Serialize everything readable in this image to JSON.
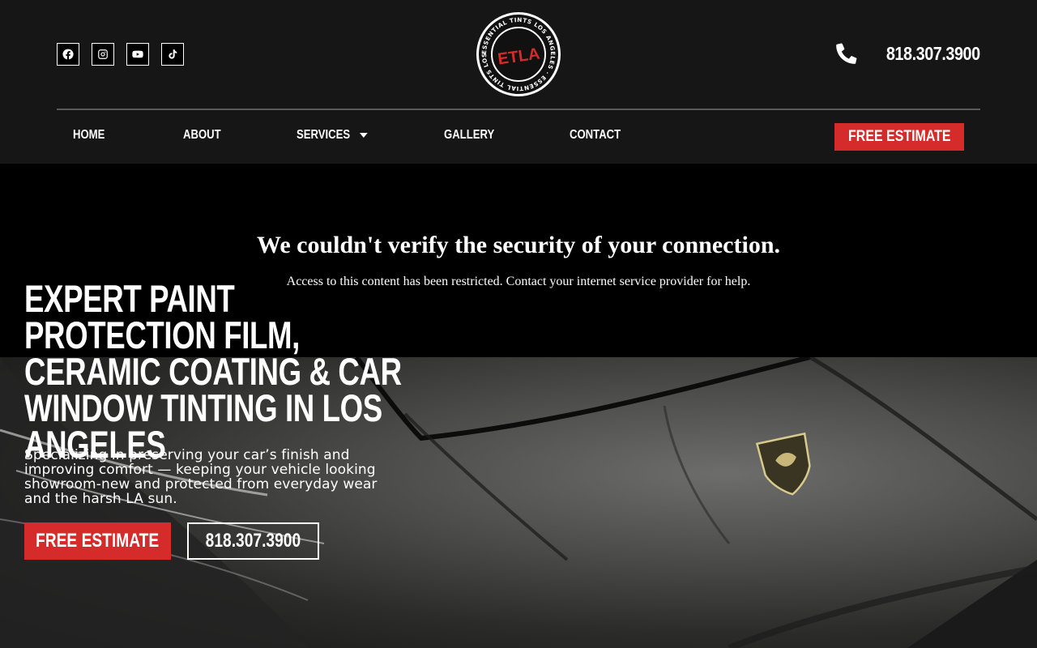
{
  "header": {
    "socials": [
      {
        "icon": "facebook-icon"
      },
      {
        "icon": "instagram-icon"
      },
      {
        "icon": "youtube-icon"
      },
      {
        "icon": "tiktok-icon"
      }
    ],
    "logo": {
      "ring_text": "ESSENTIAL TINTS LOS ANGELES · ESSENTIAL TINTS LOS ANGELES ·",
      "monogram": "ETLA"
    },
    "phone": "818.307.3900"
  },
  "nav": {
    "items": [
      "HOME",
      "ABOUT",
      "SERVICES",
      "GALLERY",
      "CONTACT"
    ],
    "cta": "FREE ESTIMATE"
  },
  "hero": {
    "title": "EXPERT PAINT PROTECTION FILM, CERAMIC COATING & CAR WINDOW TINTING IN LOS ANGELES",
    "subtitle": "Specializing in preserving your car’s finish and improving comfort — keeping your vehicle looking showroom-new and protected from everyday wear and the harsh LA sun.",
    "cta_primary": "FREE ESTIMATE",
    "cta_secondary": "818.307.3900"
  },
  "security": {
    "title": "We couldn't verify the security of your connection.",
    "message": "Access to this content has been restricted. Contact your internet service provider for help."
  },
  "colors": {
    "accent": "#d52b2b",
    "header_bg": "#161616",
    "background": "#000000"
  }
}
